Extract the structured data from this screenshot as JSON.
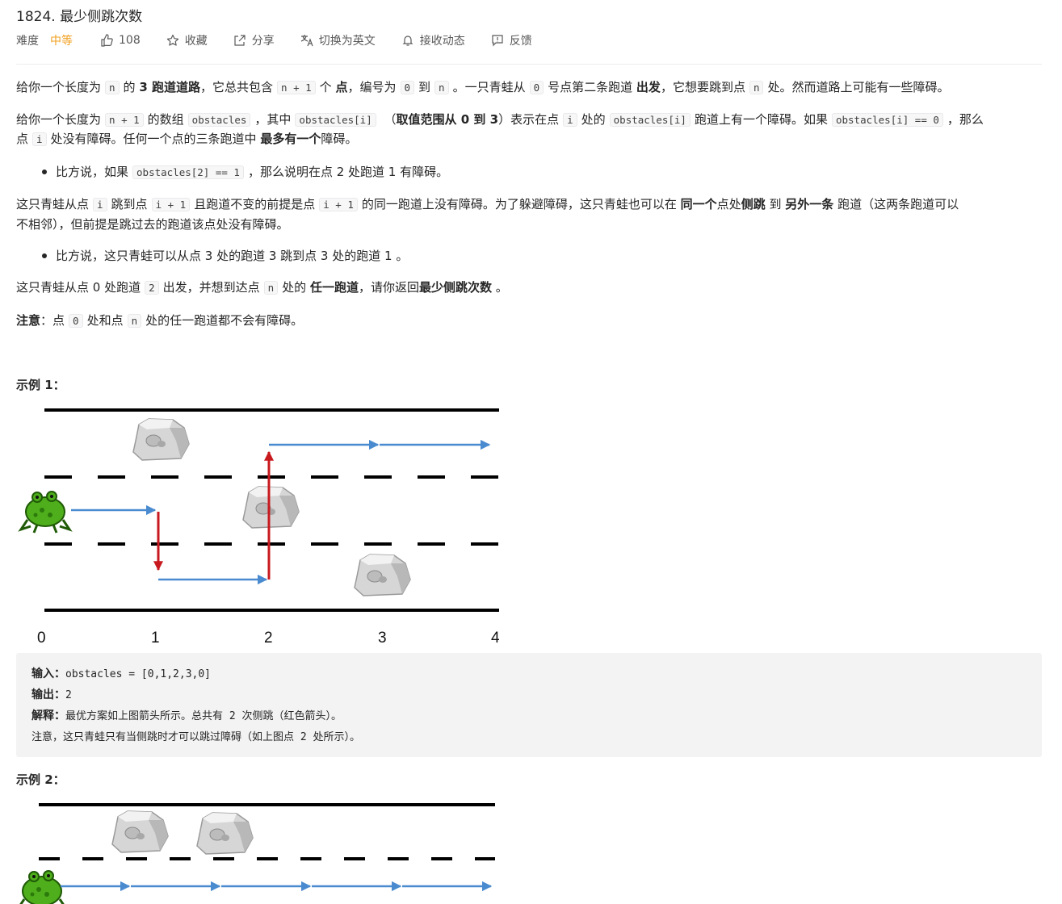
{
  "problem": {
    "title": "1824. 最少侧跳次数",
    "difficulty_label": "难度",
    "difficulty_value": "中等",
    "likes": "108",
    "actions": {
      "favorite": "收藏",
      "share": "分享",
      "switch_lang": "切换为英文",
      "subscribe": "接收动态",
      "feedback": "反馈"
    }
  },
  "desc": {
    "p1": {
      "a": "给你一个长度为",
      "c1": "n",
      "b": "的",
      "b1": "3 跑道道路",
      "c": "，它总共包含",
      "c2": "n + 1",
      "d": "个",
      "b2": "点",
      "e": "，编号为",
      "c3": "0",
      "f": "到",
      "c4": "n",
      "g": "。一只青蛙从",
      "c5": "0",
      "h": "号点第二条跑道",
      "b3": "出发",
      "i": "，它想要跳到点",
      "c6": "n",
      "j": "处。然而道路上可能有一些障碍。"
    },
    "p2": {
      "a": "给你一个长度为",
      "c1": "n + 1",
      "b": "的数组",
      "c2": "obstacles",
      "c": "，其中",
      "c3": "obstacles[i]",
      "d": "（",
      "b1": "取值范围从 0 到 3",
      "e": "）表示在点",
      "c4": "i",
      "f": "处的",
      "c5": "obstacles[i]",
      "g": "跑道上有一个障碍。如果",
      "c6": "obstacles[i] == 0",
      "h": "，那么"
    },
    "p2b": {
      "a": "点",
      "c1": "i",
      "b": "处没有障碍。任何一个点的三条跑道中",
      "b1": "最多有一个",
      "c": "障碍。"
    },
    "li1": {
      "a": "比方说，如果",
      "c1": "obstacles[2] == 1",
      "b": "，那么说明在点 2 处跑道 1 有障碍。"
    },
    "p3": {
      "a": "这只青蛙从点",
      "c1": "i",
      "b": "跳到点",
      "c2": "i + 1",
      "c": "且跑道不变的前提是点",
      "c3": "i + 1",
      "d": "的同一跑道上没有障碍。为了躲避障碍，这只青蛙也可以在",
      "b1": "同一个",
      "e": "点处",
      "b2": "侧跳",
      "f": "到",
      "b3": "另外一条",
      "g": "跑道（这两条跑道可以"
    },
    "p3b": "不相邻），但前提是跳过去的跑道该点处没有障碍。",
    "li2": "比方说，这只青蛙可以从点 3 处的跑道 3 跳到点 3 处的跑道 1 。",
    "p4": {
      "a": "这只青蛙从点 0 处跑道",
      "c1": "2",
      "b": "出发，并想到达点",
      "c2": "n",
      "c": "处的",
      "b1": "任一跑道",
      "d": "，请你返回",
      "b2": "最少侧跳次数",
      "e": "。"
    },
    "p5": {
      "b1": "注意",
      "a": "：点",
      "c1": "0",
      "b": "处和点",
      "c2": "n",
      "c": "处的任一跑道都不会有障碍。"
    }
  },
  "example1": {
    "heading": "示例 1：",
    "axis_labels": [
      "0",
      "1",
      "2",
      "3",
      "4"
    ],
    "input_label": "输入：",
    "input_value": "obstacles = [0,1,2,3,0]",
    "output_label": "输出：",
    "output_value": "2",
    "explain_label": "解释：",
    "explain_value": "最优方案如上图箭头所示。总共有 2 次侧跳（红色箭头）。",
    "note": "注意，这只青蛙只有当侧跳时才可以跳过障碍（如上图点 2 处所示）。"
  },
  "example2": {
    "heading": "示例 2："
  },
  "colors": {
    "accent_orange": "#f0a020",
    "arrow_blue": "#4a8bd0",
    "arrow_red": "#c8191e",
    "frog_green": "#4fae1b"
  }
}
